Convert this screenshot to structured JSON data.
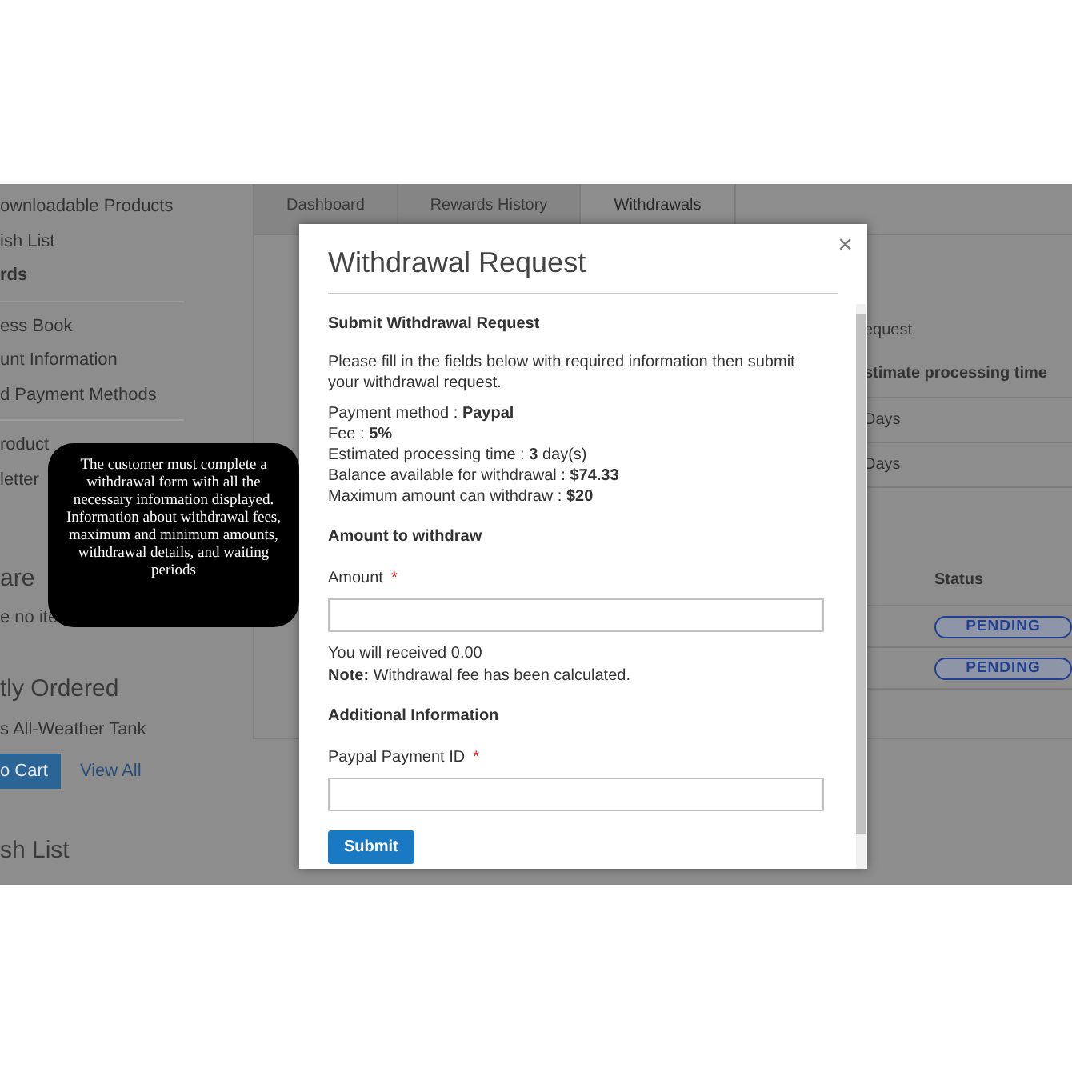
{
  "account_nav": {
    "groups": [
      {
        "items": [
          {
            "label": "ownloadable Products",
            "selected": false
          },
          {
            "label": "ish List",
            "selected": false
          },
          {
            "label": "rds",
            "selected": true
          }
        ]
      },
      {
        "items": [
          {
            "label": "ess Book",
            "selected": false
          },
          {
            "label": "unt Information",
            "selected": false
          },
          {
            "label": "d Payment Methods",
            "selected": false
          }
        ]
      },
      {
        "items": [
          {
            "label": "roduct",
            "selected": false
          },
          {
            "label": "letter",
            "selected": false
          }
        ]
      }
    ]
  },
  "compare_block": {
    "title": "are",
    "text": "e no ite"
  },
  "recently_ordered": {
    "title": "tly Ordered",
    "items": [
      "s All-Weather Tank"
    ],
    "add_button": "o Cart",
    "view_all": "View All"
  },
  "wish_list": {
    "title": "sh List"
  },
  "tabs": [
    {
      "label": "Dashboard",
      "selected": false
    },
    {
      "label": "Rewards History",
      "selected": false
    },
    {
      "label": "Withdrawals",
      "selected": true
    }
  ],
  "payment_methods_table": {
    "title": "equest",
    "header": "stimate processing time",
    "rows": [
      "Days",
      "Days"
    ]
  },
  "withdrawals_table": {
    "header": "Status",
    "rows": [
      {
        "status": "PENDING"
      },
      {
        "status": "PENDING"
      }
    ]
  },
  "modal": {
    "title": "Withdrawal Request",
    "close": "×",
    "section_title": "Submit Withdrawal Request",
    "intro": "Please fill in the fields below with required information then submit your withdrawal request.",
    "details": [
      "Payment method : **Paypal**",
      "Fee : **5%**",
      "Estimated processing time : **3** day(s)",
      "Balance available for withdrawal : **$74.33**",
      "Maximum amount can withdraw : **$20**"
    ],
    "amount_section": "Amount to withdraw",
    "amount_field": {
      "label": "Amount",
      "required_mark": "*"
    },
    "receive_text": "You will received 0.00",
    "note": "**Note:** Withdrawal fee has been calculated.",
    "additional_section": "Additional Information",
    "paypal_field": {
      "label": "Paypal Payment ID",
      "required_mark": "*"
    },
    "submit": "Submit"
  },
  "tooltip": {
    "paragraphs": [
      "The customer must complete a withdrawal form with all the necessary information displayed.",
      "Information about withdrawal fees, maximum and minimum amounts, withdrawal details, and waiting periods"
    ]
  }
}
